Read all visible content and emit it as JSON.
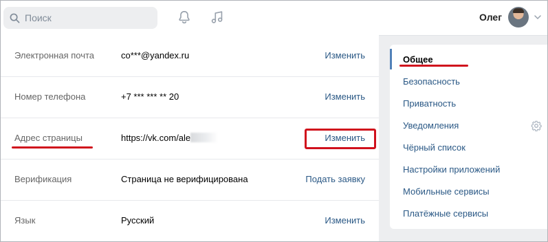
{
  "header": {
    "search_placeholder": "Поиск",
    "user_name": "Олег"
  },
  "settings": {
    "rows": [
      {
        "label": "Электронная почта",
        "value": "co***@yandex.ru",
        "action": "Изменить"
      },
      {
        "label": "Номер телефона",
        "value": "+7 *** *** ** 20",
        "action": "Изменить"
      },
      {
        "label": "Адрес страницы",
        "value": "https://vk.com/ale",
        "action": "Изменить"
      },
      {
        "label": "Верификация",
        "value": "Страница не верифицирована",
        "action": "Подать заявку"
      },
      {
        "label": "Язык",
        "value": "Русский",
        "action": "Изменить"
      }
    ]
  },
  "menu": {
    "items": [
      {
        "label": "Общее",
        "active": true
      },
      {
        "label": "Безопасность"
      },
      {
        "label": "Приватность"
      },
      {
        "label": "Уведомления"
      },
      {
        "label": "Чёрный список"
      },
      {
        "label": "Настройки приложений"
      },
      {
        "label": "Мобильные сервисы"
      },
      {
        "label": "Платёжные сервисы"
      }
    ]
  },
  "colors": {
    "link": "#2a5885",
    "highlight": "#d0101c",
    "active_bar": "#5181b8"
  },
  "icons": [
    "search-icon",
    "bell-icon",
    "music-note-icon",
    "chevron-down-icon",
    "gear-icon"
  ]
}
